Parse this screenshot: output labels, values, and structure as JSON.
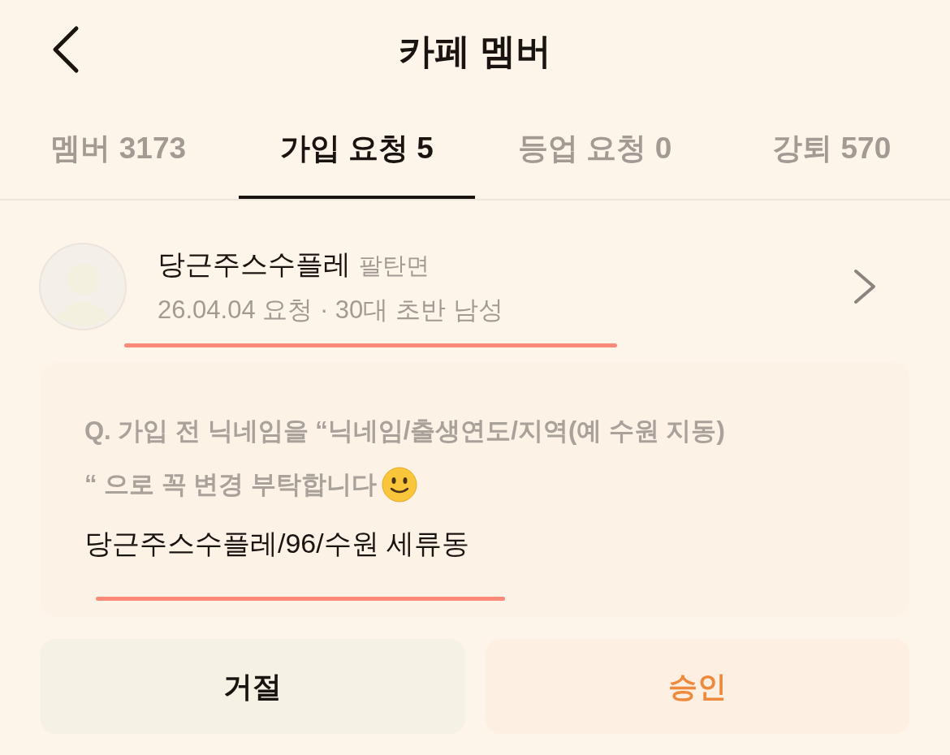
{
  "header": {
    "title": "카페 멤버"
  },
  "tabs": [
    {
      "label": "멤버 3173",
      "selected": false
    },
    {
      "label": "가입 요청 5",
      "selected": true
    },
    {
      "label": "등업 요청 0",
      "selected": false
    },
    {
      "label": "강퇴 570",
      "selected": false
    }
  ],
  "request": {
    "name": "당근주스수플레",
    "region": "팔탄면",
    "meta": "26.04.04 요청 · 30대 초반 남성",
    "question_lines": [
      "Q. 가입 전 닉네임을 “닉네임/출생연도/지역(예 수원 지동)",
      "“ 으로 꼭 변경 부탁합니다"
    ],
    "answer": "당근주스수플레/96/수원 세류동"
  },
  "buttons": [
    {
      "label": "거절",
      "kind": "reject"
    },
    {
      "label": "승인",
      "kind": "approve"
    }
  ]
}
